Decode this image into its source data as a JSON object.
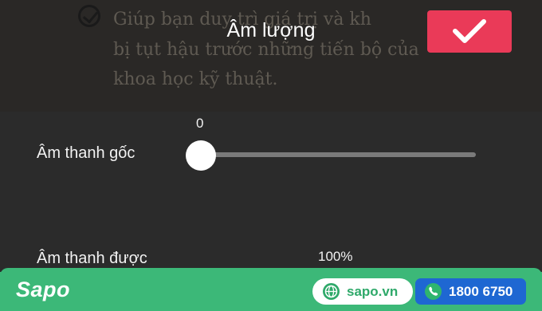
{
  "background_doc": {
    "line1": "Giúp bạn duy trì giá trị và kh",
    "line2": "bị tụt hậu trước những tiến bộ của",
    "line3": "khoa học kỹ thuật."
  },
  "header": {
    "title": "Âm lượng",
    "confirm_icon": "checkmark-icon"
  },
  "original_sound": {
    "label": "Âm thanh gốc",
    "value_text": "0",
    "level": 0
  },
  "added_sound": {
    "label": "Âm thanh được",
    "value_text": "100%",
    "level": 1.0
  },
  "footer": {
    "logo": "Sapo",
    "website": "sapo.vn",
    "phone": "1800 6750",
    "globe_icon": "globe-icon",
    "phone_icon": "phone-icon"
  },
  "colors": {
    "panel": "#2b2b2b",
    "accent": "#ea3a58",
    "footer": "#3cb878",
    "phone_pill": "#1e67d2"
  }
}
